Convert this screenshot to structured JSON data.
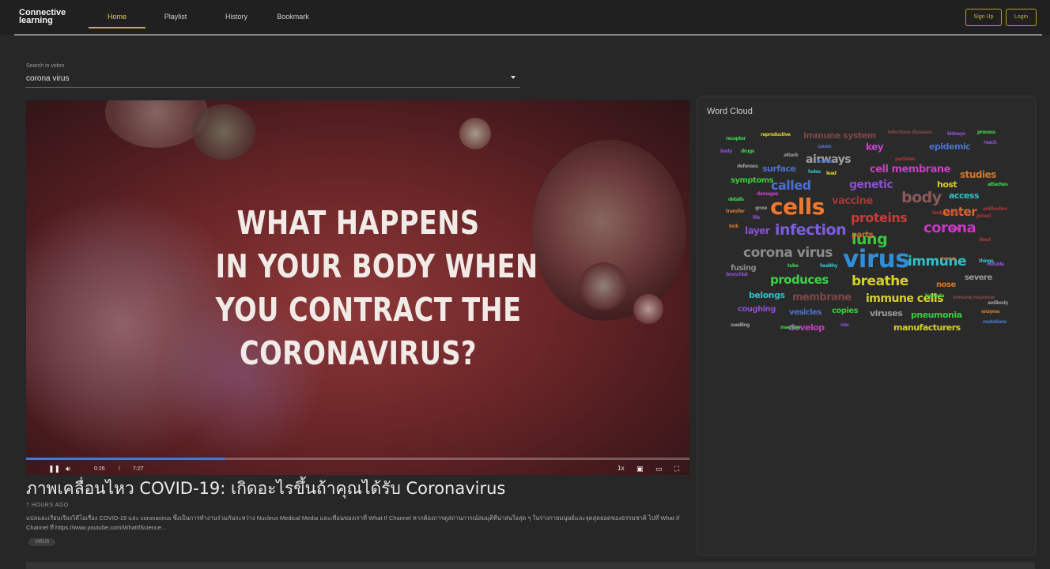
{
  "brand": "Connective\nlearning",
  "nav": [
    "Home",
    "Playlist",
    "History",
    "Bookmark"
  ],
  "auth": {
    "signup": "Sign Up",
    "login": "Login"
  },
  "search": {
    "label": "Search in video",
    "value": "corona virus"
  },
  "video": {
    "overlay_title": "WHAT HAPPENS\nIN YOUR BODY WHEN\nYOU CONTRACT THE\nCORONAVIRUS?",
    "current_time": "0:26",
    "separator": "/",
    "duration": "7:27",
    "speed": "1x",
    "progress_fraction": 0.3
  },
  "video_info": {
    "title": "ภาพเคลื่อนไหว COVID-19: เกิดอะไรขึ้นถ้าคุณได้รับ Coronavirus",
    "time_ago": "7 HOURS AGO",
    "description": "แปลและเรียบเรียงวิดีโอเรื่อง COVID-19 และ coronavirus ซึ่งเป็นการทำงานร่วมกันระหว่าง Nucleus Medical Media และเพื่อนของเราที่ What If Channel หากต้องการดูสถานการณ์สมมุติที่น่าสนใจสุด ๆ ในร่างกายมนุษย์และจุดสุดยอดของธรรมชาติ ไปที่ What If Channel ที่ https://www.youtube.com/WhatIfScience...",
    "tag": "VIRUS"
  },
  "word_cloud": {
    "title": "Word Cloud",
    "words": [
      {
        "text": "cells",
        "color": "#f0772e"
      },
      {
        "text": "virus",
        "color": "#2f8ed6"
      },
      {
        "text": "corona virus",
        "color": "#8b8b8b"
      },
      {
        "text": "infection",
        "color": "#7b5ee0"
      },
      {
        "text": "lung",
        "color": "#3cc73c"
      },
      {
        "text": "corona",
        "color": "#c936c6"
      },
      {
        "text": "body",
        "color": "#8a5a5a"
      },
      {
        "text": "proteins",
        "color": "#c93a3a"
      },
      {
        "text": "breathe",
        "color": "#d7cf2a"
      },
      {
        "text": "immune",
        "color": "#2ec0c8"
      },
      {
        "text": "produces",
        "color": "#3fd04a"
      },
      {
        "text": "cell membrane",
        "color": "#c53fc0"
      },
      {
        "text": "airways",
        "color": "#a0a0a0"
      },
      {
        "text": "called",
        "color": "#4a6fd2"
      },
      {
        "text": "genetic",
        "color": "#8b4fd0"
      },
      {
        "text": "immune cells",
        "color": "#d6cf2a"
      },
      {
        "text": "membrane",
        "color": "#7e4646"
      },
      {
        "text": "enter",
        "color": "#e0662e"
      },
      {
        "text": "studies",
        "color": "#d0762d"
      },
      {
        "text": "immune system",
        "color": "#7e4646"
      },
      {
        "text": "epidemic",
        "color": "#4a72c9"
      },
      {
        "text": "key",
        "color": "#cc3fc4"
      },
      {
        "text": "host",
        "color": "#d7cf2a"
      },
      {
        "text": "access",
        "color": "#2ec0c8"
      },
      {
        "text": "vaccine",
        "color": "#a33636"
      },
      {
        "text": "surface",
        "color": "#4a72c9"
      },
      {
        "text": "symptoms",
        "color": "#3cc73c"
      },
      {
        "text": "layer",
        "color": "#8b4fd0"
      },
      {
        "text": "parts",
        "color": "#e0662e"
      },
      {
        "text": "severe",
        "color": "#9a9a9a"
      },
      {
        "text": "nose",
        "color": "#d0762d"
      },
      {
        "text": "belongs",
        "color": "#2ec0c8"
      },
      {
        "text": "coughing",
        "color": "#8b4fd0"
      },
      {
        "text": "vesicles",
        "color": "#4a72c9"
      },
      {
        "text": "copies",
        "color": "#3cc73c"
      },
      {
        "text": "viruses",
        "color": "#9a9a9a"
      },
      {
        "text": "pneumonia",
        "color": "#3cc73c"
      },
      {
        "text": "develop",
        "color": "#c53fc0"
      },
      {
        "text": "manufacturers",
        "color": "#d7cf2a"
      },
      {
        "text": "fusing",
        "color": "#8b8b8b"
      },
      {
        "text": "receptor",
        "color": "#3fd04a"
      },
      {
        "text": "reproductive",
        "color": "#d7cf2a"
      },
      {
        "text": "infectious diseases",
        "color": "#7e4646"
      },
      {
        "text": "kidneys",
        "color": "#8b4fd0"
      },
      {
        "text": "process",
        "color": "#3fd04a"
      },
      {
        "text": "cause",
        "color": "#4a72c9"
      },
      {
        "text": "reach",
        "color": "#8b4fd0"
      },
      {
        "text": "body",
        "color": "#8b4fd0"
      },
      {
        "text": "drugs",
        "color": "#3fd04a"
      },
      {
        "text": "attack",
        "color": "#9a9a9a"
      },
      {
        "text": "travels",
        "color": "#4a72c9"
      },
      {
        "text": "particles",
        "color": "#a33636"
      },
      {
        "text": "defenses",
        "color": "#9a9a9a"
      },
      {
        "text": "holes",
        "color": "#2ec0c8"
      },
      {
        "text": "lead",
        "color": "#d7cf2a"
      },
      {
        "text": "attaches",
        "color": "#3fd04a"
      },
      {
        "text": "damages",
        "color": "#c53fc0"
      },
      {
        "text": "details",
        "color": "#3fd04a"
      },
      {
        "text": "grow",
        "color": "#9a9a9a"
      },
      {
        "text": "transfer",
        "color": "#d0762d"
      },
      {
        "text": "life",
        "color": "#8b4fd0"
      },
      {
        "text": "lock",
        "color": "#d0762d"
      },
      {
        "text": "joined",
        "color": "#a33636"
      },
      {
        "text": "tube",
        "color": "#3fd04a"
      },
      {
        "text": "healthy",
        "color": "#2ec0c8"
      },
      {
        "text": "outside",
        "color": "#8b4fd0"
      },
      {
        "text": "things",
        "color": "#2ec0c8"
      },
      {
        "text": "dead",
        "color": "#a33636"
      },
      {
        "text": "bronchial",
        "color": "#8b4fd0"
      },
      {
        "text": "mucus",
        "color": "#d0762d"
      },
      {
        "text": "body weight",
        "color": "#a33636"
      },
      {
        "text": "immune response",
        "color": "#7e4646"
      },
      {
        "text": "antibody",
        "color": "#9a9a9a"
      },
      {
        "text": "mutations",
        "color": "#4a72c9"
      },
      {
        "text": "enzyme",
        "color": "#d0762d"
      },
      {
        "text": "bacteria",
        "color": "#3fd04a"
      },
      {
        "text": "machine",
        "color": "#3fd04a"
      },
      {
        "text": "mix",
        "color": "#8b4fd0"
      },
      {
        "text": "antibodies",
        "color": "#a33636"
      },
      {
        "text": "skin",
        "color": "#c53fc0"
      },
      {
        "text": "swelling",
        "color": "#9a9a9a"
      }
    ]
  }
}
